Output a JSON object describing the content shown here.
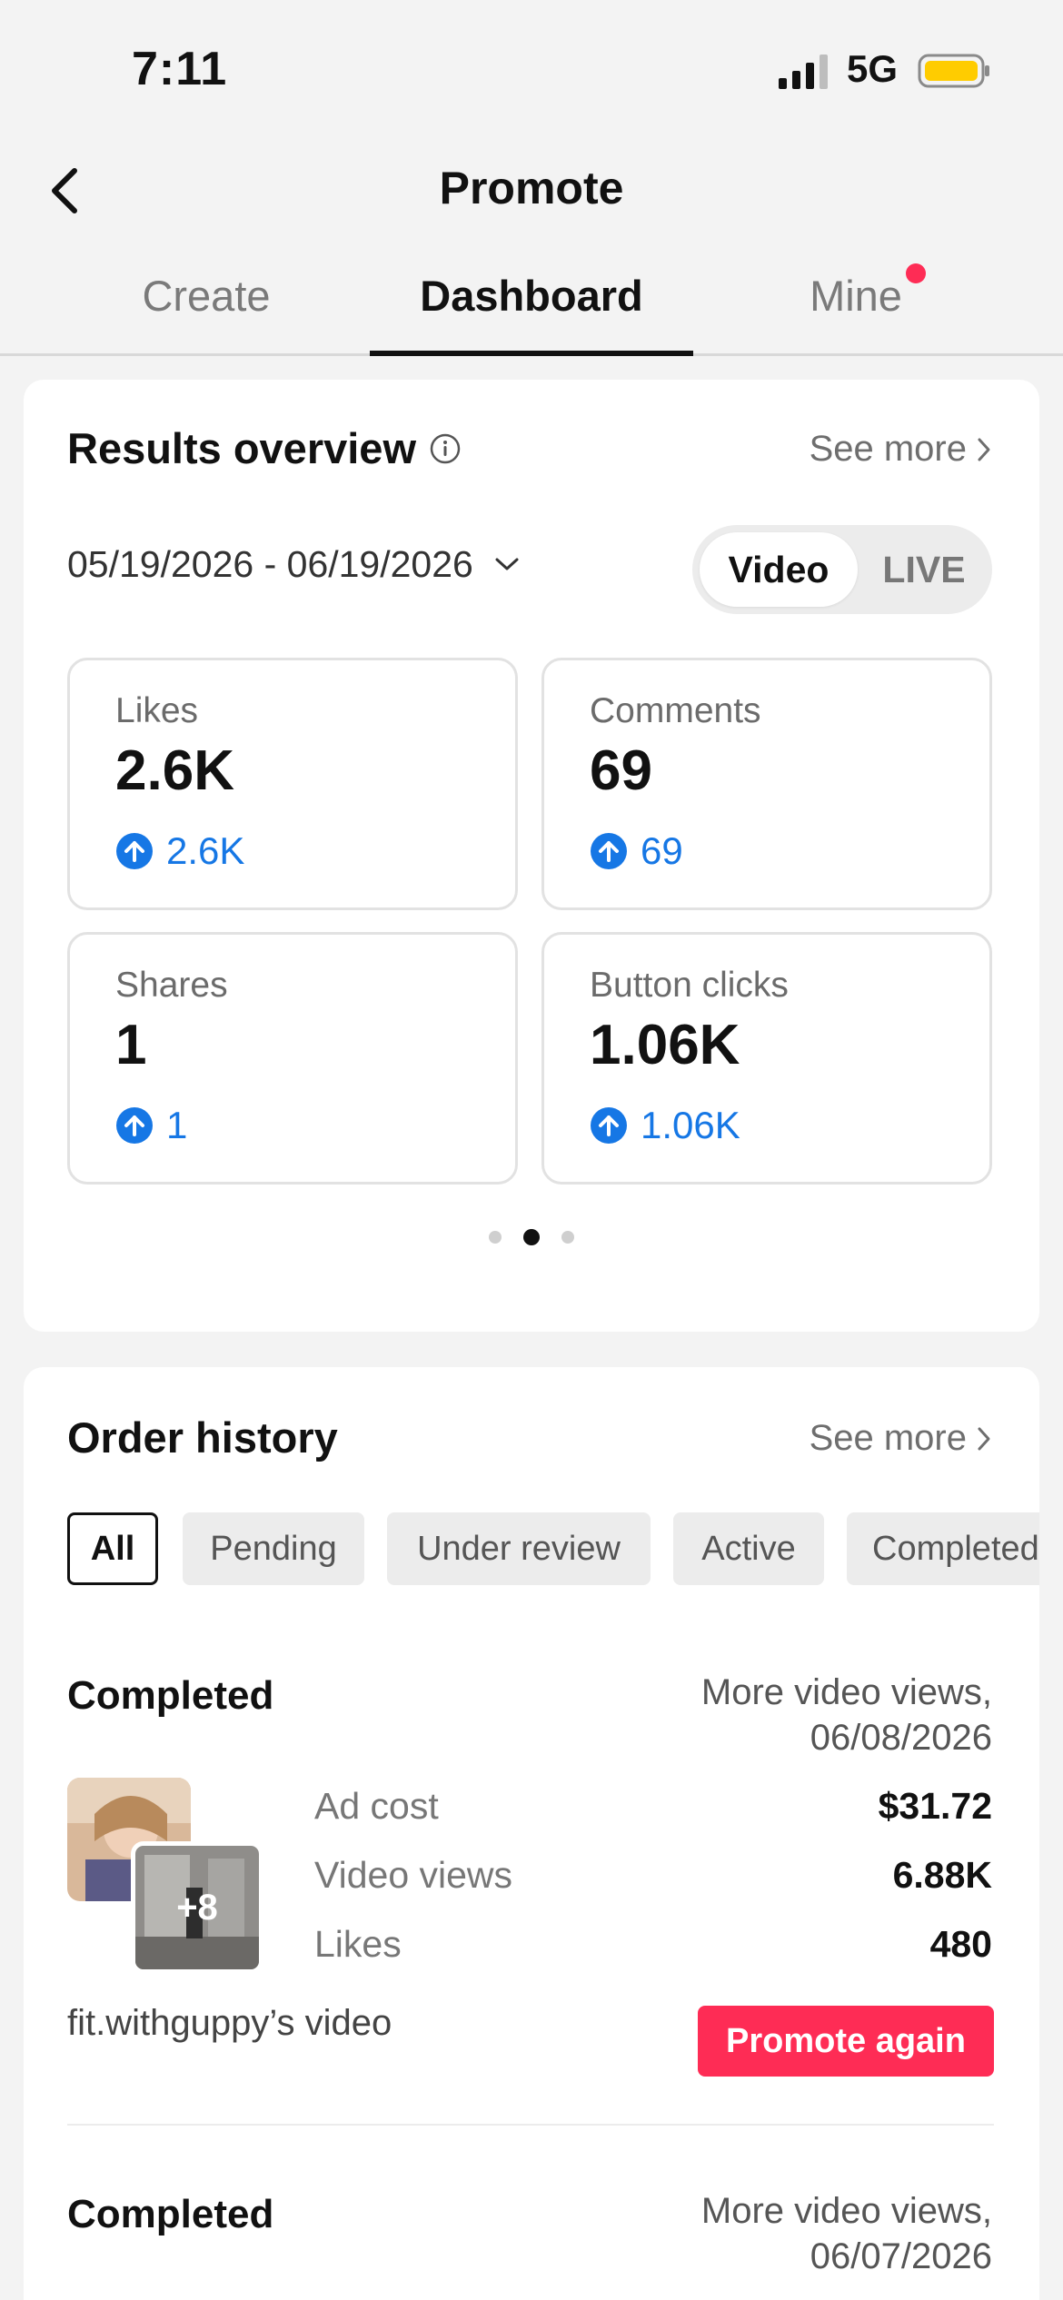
{
  "status_bar": {
    "time": "7:11",
    "network": "5G",
    "battery_color": "#ffcc00"
  },
  "nav": {
    "title": "Promote"
  },
  "tabs": [
    {
      "label": "Create"
    },
    {
      "label": "Dashboard",
      "active": true
    },
    {
      "label": "Mine",
      "has_badge": true
    }
  ],
  "results": {
    "title": "Results overview",
    "see_more": "See more",
    "date_range": "05/19/2026 - 06/19/2026",
    "segments": [
      "Video",
      "LIVE"
    ],
    "selected_segment": "Video",
    "metrics": [
      {
        "label": "Likes",
        "value": "2.6K",
        "delta": "2.6K"
      },
      {
        "label": "Comments",
        "value": "69",
        "delta": "69"
      },
      {
        "label": "Shares",
        "value": "1",
        "delta": "1"
      },
      {
        "label": "Button clicks",
        "value": "1.06K",
        "delta": "1.06K"
      }
    ],
    "pager": {
      "pages": 3,
      "current": 2
    }
  },
  "orders": {
    "title": "Order history",
    "see_more": "See more",
    "filters": [
      "All",
      "Pending",
      "Under review",
      "Active",
      "Completed"
    ],
    "active_filter": "All",
    "items": [
      {
        "status": "Completed",
        "desc_line1": "More video views,",
        "desc_line2": "06/08/2026",
        "thumb_count": "+8",
        "stats": [
          {
            "label": "Ad cost",
            "value": "$31.72"
          },
          {
            "label": "Video views",
            "value": "6.88K"
          },
          {
            "label": "Likes",
            "value": "480"
          }
        ],
        "owner": "fit.withguppy’s video",
        "action": "Promote again"
      },
      {
        "status": "Completed",
        "desc_line1": "More video views,",
        "desc_line2": "06/07/2026"
      }
    ]
  },
  "colors": {
    "accent": "#fe2c55",
    "delta_blue": "#1677e5"
  }
}
